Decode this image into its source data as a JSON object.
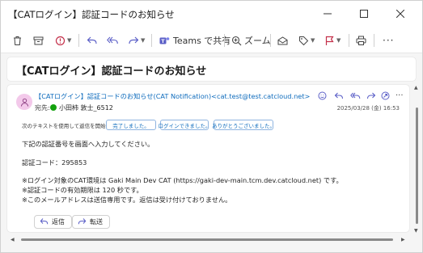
{
  "window": {
    "title": "【CATログイン】認証コードのお知らせ",
    "controls": [
      "minimize-icon",
      "maximize-icon",
      "close-icon"
    ]
  },
  "toolbar": {
    "items": [
      {
        "icon": "trash-icon"
      },
      {
        "icon": "archive-icon"
      },
      {
        "icon": "report-icon"
      },
      {
        "icon": "reply-icon"
      },
      {
        "icon": "reply-all-icon"
      },
      {
        "icon": "forward-icon"
      },
      {
        "icon": "teams-icon",
        "label": "Teams で共有"
      },
      {
        "icon": "zoom-icon",
        "label": "ズーム"
      },
      {
        "icon": "read-unread-icon"
      },
      {
        "icon": "tag-icon"
      },
      {
        "icon": "flag-icon"
      },
      {
        "icon": "print-icon"
      },
      {
        "icon": "more-icon"
      }
    ],
    "teams_label": "Teams で共有",
    "zoom_label": "ズーム"
  },
  "message": {
    "subject": "【CATログイン】認証コードのお知らせ",
    "from": "【CATログイン】認証コードのお知らせ(CAT Notification)<cat.test@test.catcloud.net>",
    "to_label": "宛先:",
    "to_name": "小田柿 敦士_6512",
    "date": "2025/03/28 (金) 16:53",
    "suggest_label": "次のテキストを使用して返信を開始する:",
    "suggestions": [
      "完了しました。",
      "ログインできました。",
      "ありがとうございました。"
    ],
    "body": [
      "下記の認証番号を画面へ入力してください。",
      "認証コード：295853",
      "※ログイン対象のCAT環境は Gaki Main Dev CAT (https://gaki-dev-main.tcm.dev.catcloud.net) です。",
      "※認証コードの有効期限は 120 秒です。",
      "※このメールアドレスは送信専用です。返信は受け付けておりません。"
    ],
    "reply_label": "返信",
    "forward_label": "転送"
  },
  "colors": {
    "accent": "#0f6cbd",
    "avatar_bg": "#f3c9ea",
    "presence": "#13a10e",
    "report_icon": "#c4314b",
    "flag_icon": "#c4314b",
    "teams_icon": "#5b5fc7"
  }
}
